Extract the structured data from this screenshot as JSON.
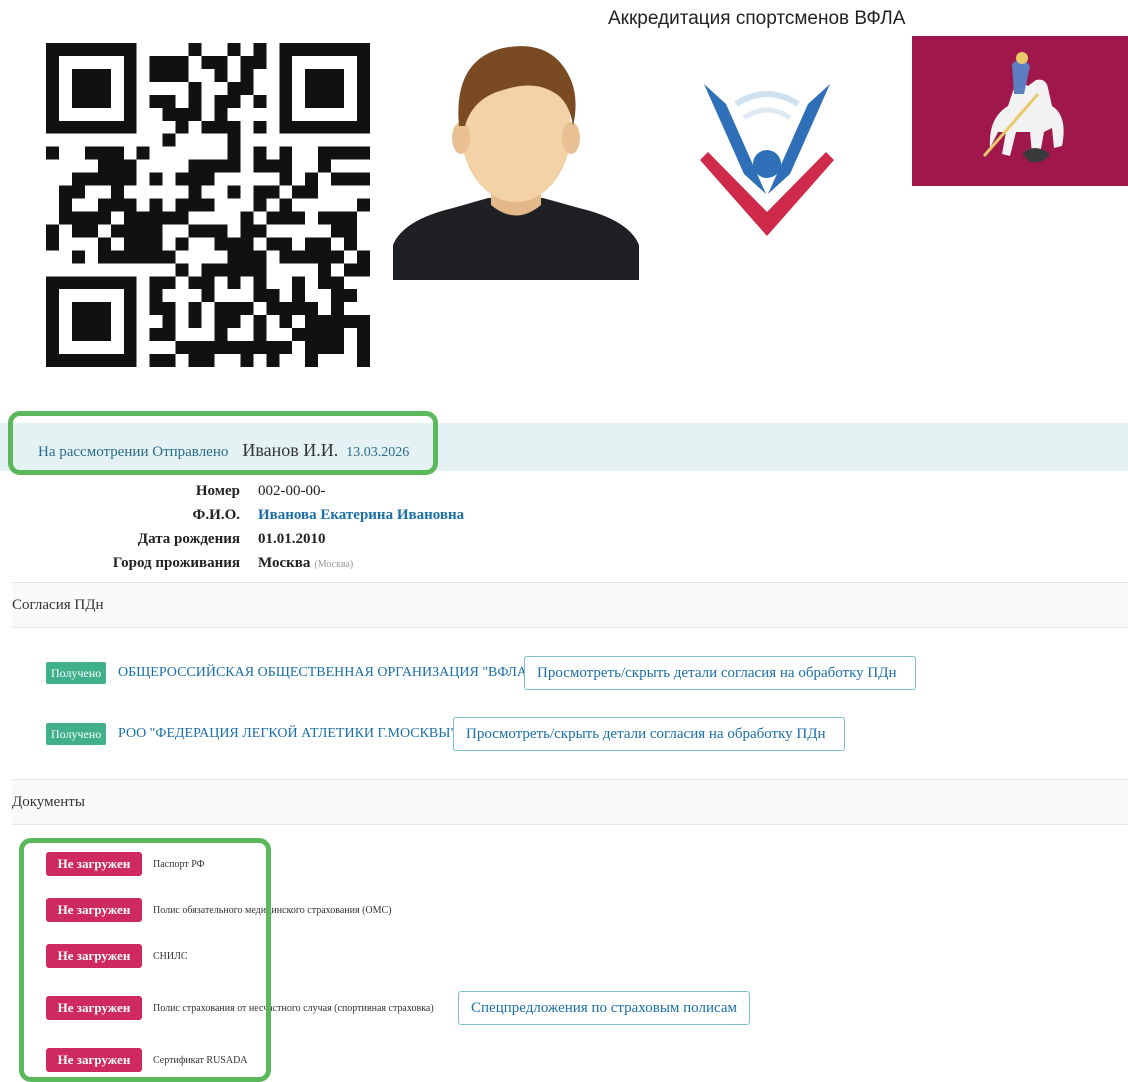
{
  "header": {
    "title": "Аккредитация спортсменов ВФЛА"
  },
  "colors": {
    "accent": "#1a6fa8",
    "success": "#3fb08b",
    "danger": "#cf2a60",
    "highlight_frame": "#5cb85c",
    "flag": "#a0174c"
  },
  "status": {
    "state": "На рассмотрении Отправлено",
    "name": "Иванов И.И.",
    "date": "13.03.2026"
  },
  "info": [
    {
      "label": "Номер",
      "value": "002-00-00-",
      "extra": ""
    },
    {
      "label": "Ф.И.О.",
      "value": "Иванова Екатерина Ивановна",
      "extra": ""
    },
    {
      "label": "Дата рождения",
      "value": "01.01.2010",
      "extra": ""
    },
    {
      "label": "Город проживания",
      "value": "Москва",
      "extra": "(Москва)"
    }
  ],
  "consents": {
    "title": "Согласия ПДн",
    "items": [
      {
        "badge": "Получено",
        "org": "ОБЩЕРОССИЙСКАЯ ОБЩЕСТВЕННАЯ ОРГАНИЗАЦИЯ \"ВФЛА\"",
        "button": "Просмотреть/скрыть детали согласия на обработку ПДн"
      },
      {
        "badge": "Получено",
        "org": "РОО \"ФЕДЕРАЦИЯ ЛЕГКОЙ АТЛЕТИКИ Г.МОСКВЫ\"",
        "button": "Просмотреть/скрыть детали согласия на обработку ПДн"
      }
    ]
  },
  "documents": {
    "title": "Документы",
    "items": [
      {
        "badge": "Не загружен",
        "name": "Паспорт РФ"
      },
      {
        "badge": "Не загружен",
        "name": "Полис обязательного медицинского страхования (ОМС)"
      },
      {
        "badge": "Не загружен",
        "name": "СНИЛС"
      },
      {
        "badge": "Не загружен",
        "name": "Полис страхования от несчастного случая (спортивная страховка)"
      },
      {
        "badge": "Не загружен",
        "name": "Сертификат RUSADA"
      }
    ],
    "insurance_button": "Спецпредложения по страховым полисам"
  },
  "icons": {
    "qr": "qr-code-icon",
    "avatar": "user-avatar-icon",
    "logo": "federation-logo-icon",
    "flag": "moscow-flag-icon"
  }
}
